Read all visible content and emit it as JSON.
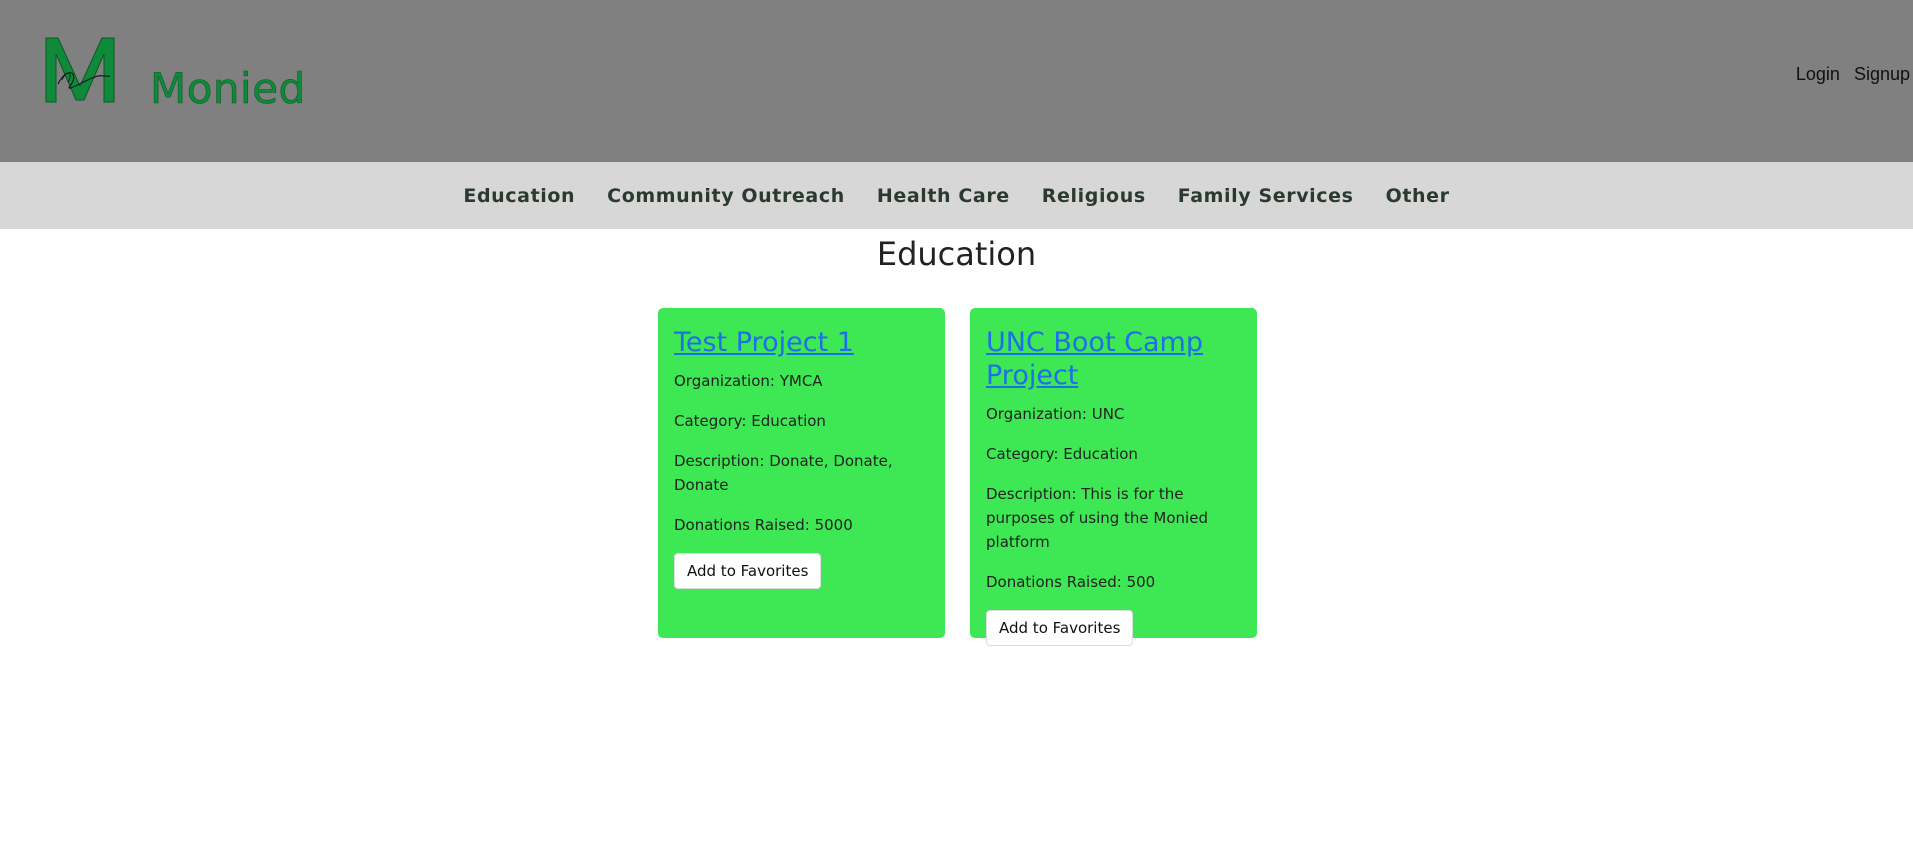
{
  "header": {
    "brand": "Monied",
    "login_label": "Login",
    "signup_label": "Signup"
  },
  "nav": {
    "items": [
      {
        "label": "Education"
      },
      {
        "label": "Community Outreach"
      },
      {
        "label": "Health Care"
      },
      {
        "label": "Religious"
      },
      {
        "label": "Family Services"
      },
      {
        "label": "Other"
      }
    ]
  },
  "main": {
    "title": "Education",
    "cards": [
      {
        "title": "Test Project 1",
        "organization": "Organization: YMCA",
        "category": "Category: Education",
        "description": "Description: Donate, Donate, Donate",
        "donations": "Donations Raised: 5000",
        "button_label": "Add to Favorites"
      },
      {
        "title": "UNC Boot Camp Project",
        "organization": "Organization: UNC",
        "category": "Category: Education",
        "description": "Description: This is for the purposes of using the Monied platform",
        "donations": "Donations Raised: 500",
        "button_label": "Add to Favorites"
      }
    ]
  },
  "colors": {
    "header_bg": "#808080",
    "nav_bg": "#d7d7d7",
    "card_bg": "#3de854",
    "brand": "#0e8a3a",
    "link": "#1e6fe8"
  },
  "icons": {
    "logo": "monied-logo-icon"
  }
}
